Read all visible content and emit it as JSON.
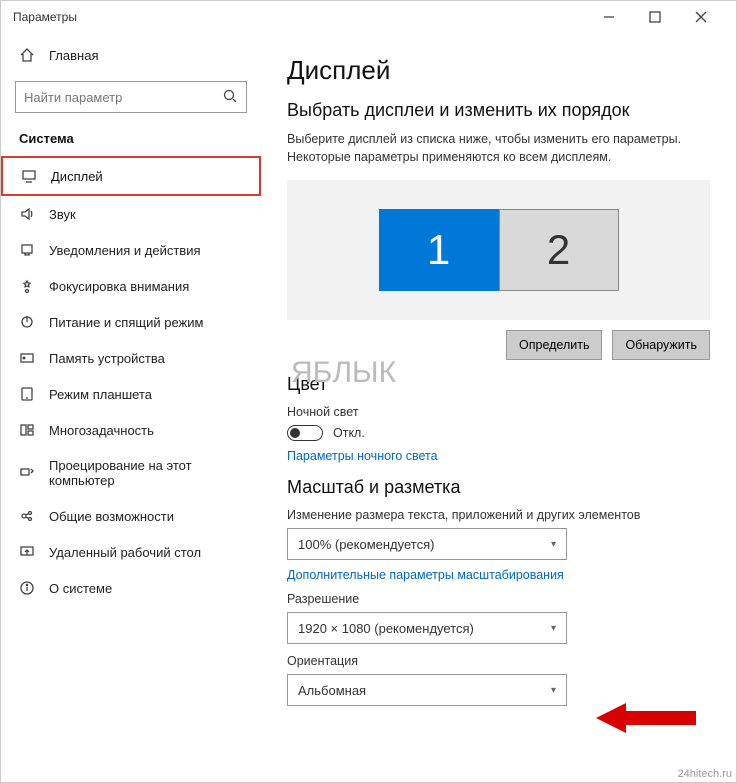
{
  "window": {
    "title": "Параметры"
  },
  "sidebar": {
    "home": "Главная",
    "search_placeholder": "Найти параметр",
    "section": "Система",
    "items": [
      {
        "label": "Дисплей",
        "icon": "display-icon",
        "selected": true
      },
      {
        "label": "Звук",
        "icon": "sound-icon"
      },
      {
        "label": "Уведомления и действия",
        "icon": "notifications-icon"
      },
      {
        "label": "Фокусировка внимания",
        "icon": "focus-assist-icon"
      },
      {
        "label": "Питание и спящий режим",
        "icon": "power-icon"
      },
      {
        "label": "Память устройства",
        "icon": "storage-icon"
      },
      {
        "label": "Режим планшета",
        "icon": "tablet-icon"
      },
      {
        "label": "Многозадачность",
        "icon": "multitasking-icon"
      },
      {
        "label": "Проецирование на этот компьютер",
        "icon": "projecting-icon"
      },
      {
        "label": "Общие возможности",
        "icon": "shared-experiences-icon"
      },
      {
        "label": "Удаленный рабочий стол",
        "icon": "remote-desktop-icon"
      },
      {
        "label": "О системе",
        "icon": "about-icon"
      }
    ]
  },
  "main": {
    "title": "Дисплей",
    "arrange_heading": "Выбрать дисплеи и изменить их порядок",
    "arrange_desc": "Выберите дисплей из списка ниже, чтобы изменить его параметры. Некоторые параметры применяются ко всем дисплеям.",
    "monitors": [
      "1",
      "2"
    ],
    "buttons": {
      "identify": "Определить",
      "detect": "Обнаружить"
    },
    "color_heading": "Цвет",
    "night_light_label": "Ночной свет",
    "night_light_state": "Откл.",
    "night_light_link": "Параметры ночного света",
    "scale_heading": "Масштаб и разметка",
    "scale_label": "Изменение размера текста, приложений и других элементов",
    "scale_value": "100% (рекомендуется)",
    "scale_link": "Дополнительные параметры масштабирования",
    "resolution_label": "Разрешение",
    "resolution_value": "1920 × 1080 (рекомендуется)",
    "orientation_label": "Ориентация",
    "orientation_value": "Альбомная"
  },
  "watermark": "ЯБЛЫК",
  "watermark_corner": "24hitech.ru"
}
